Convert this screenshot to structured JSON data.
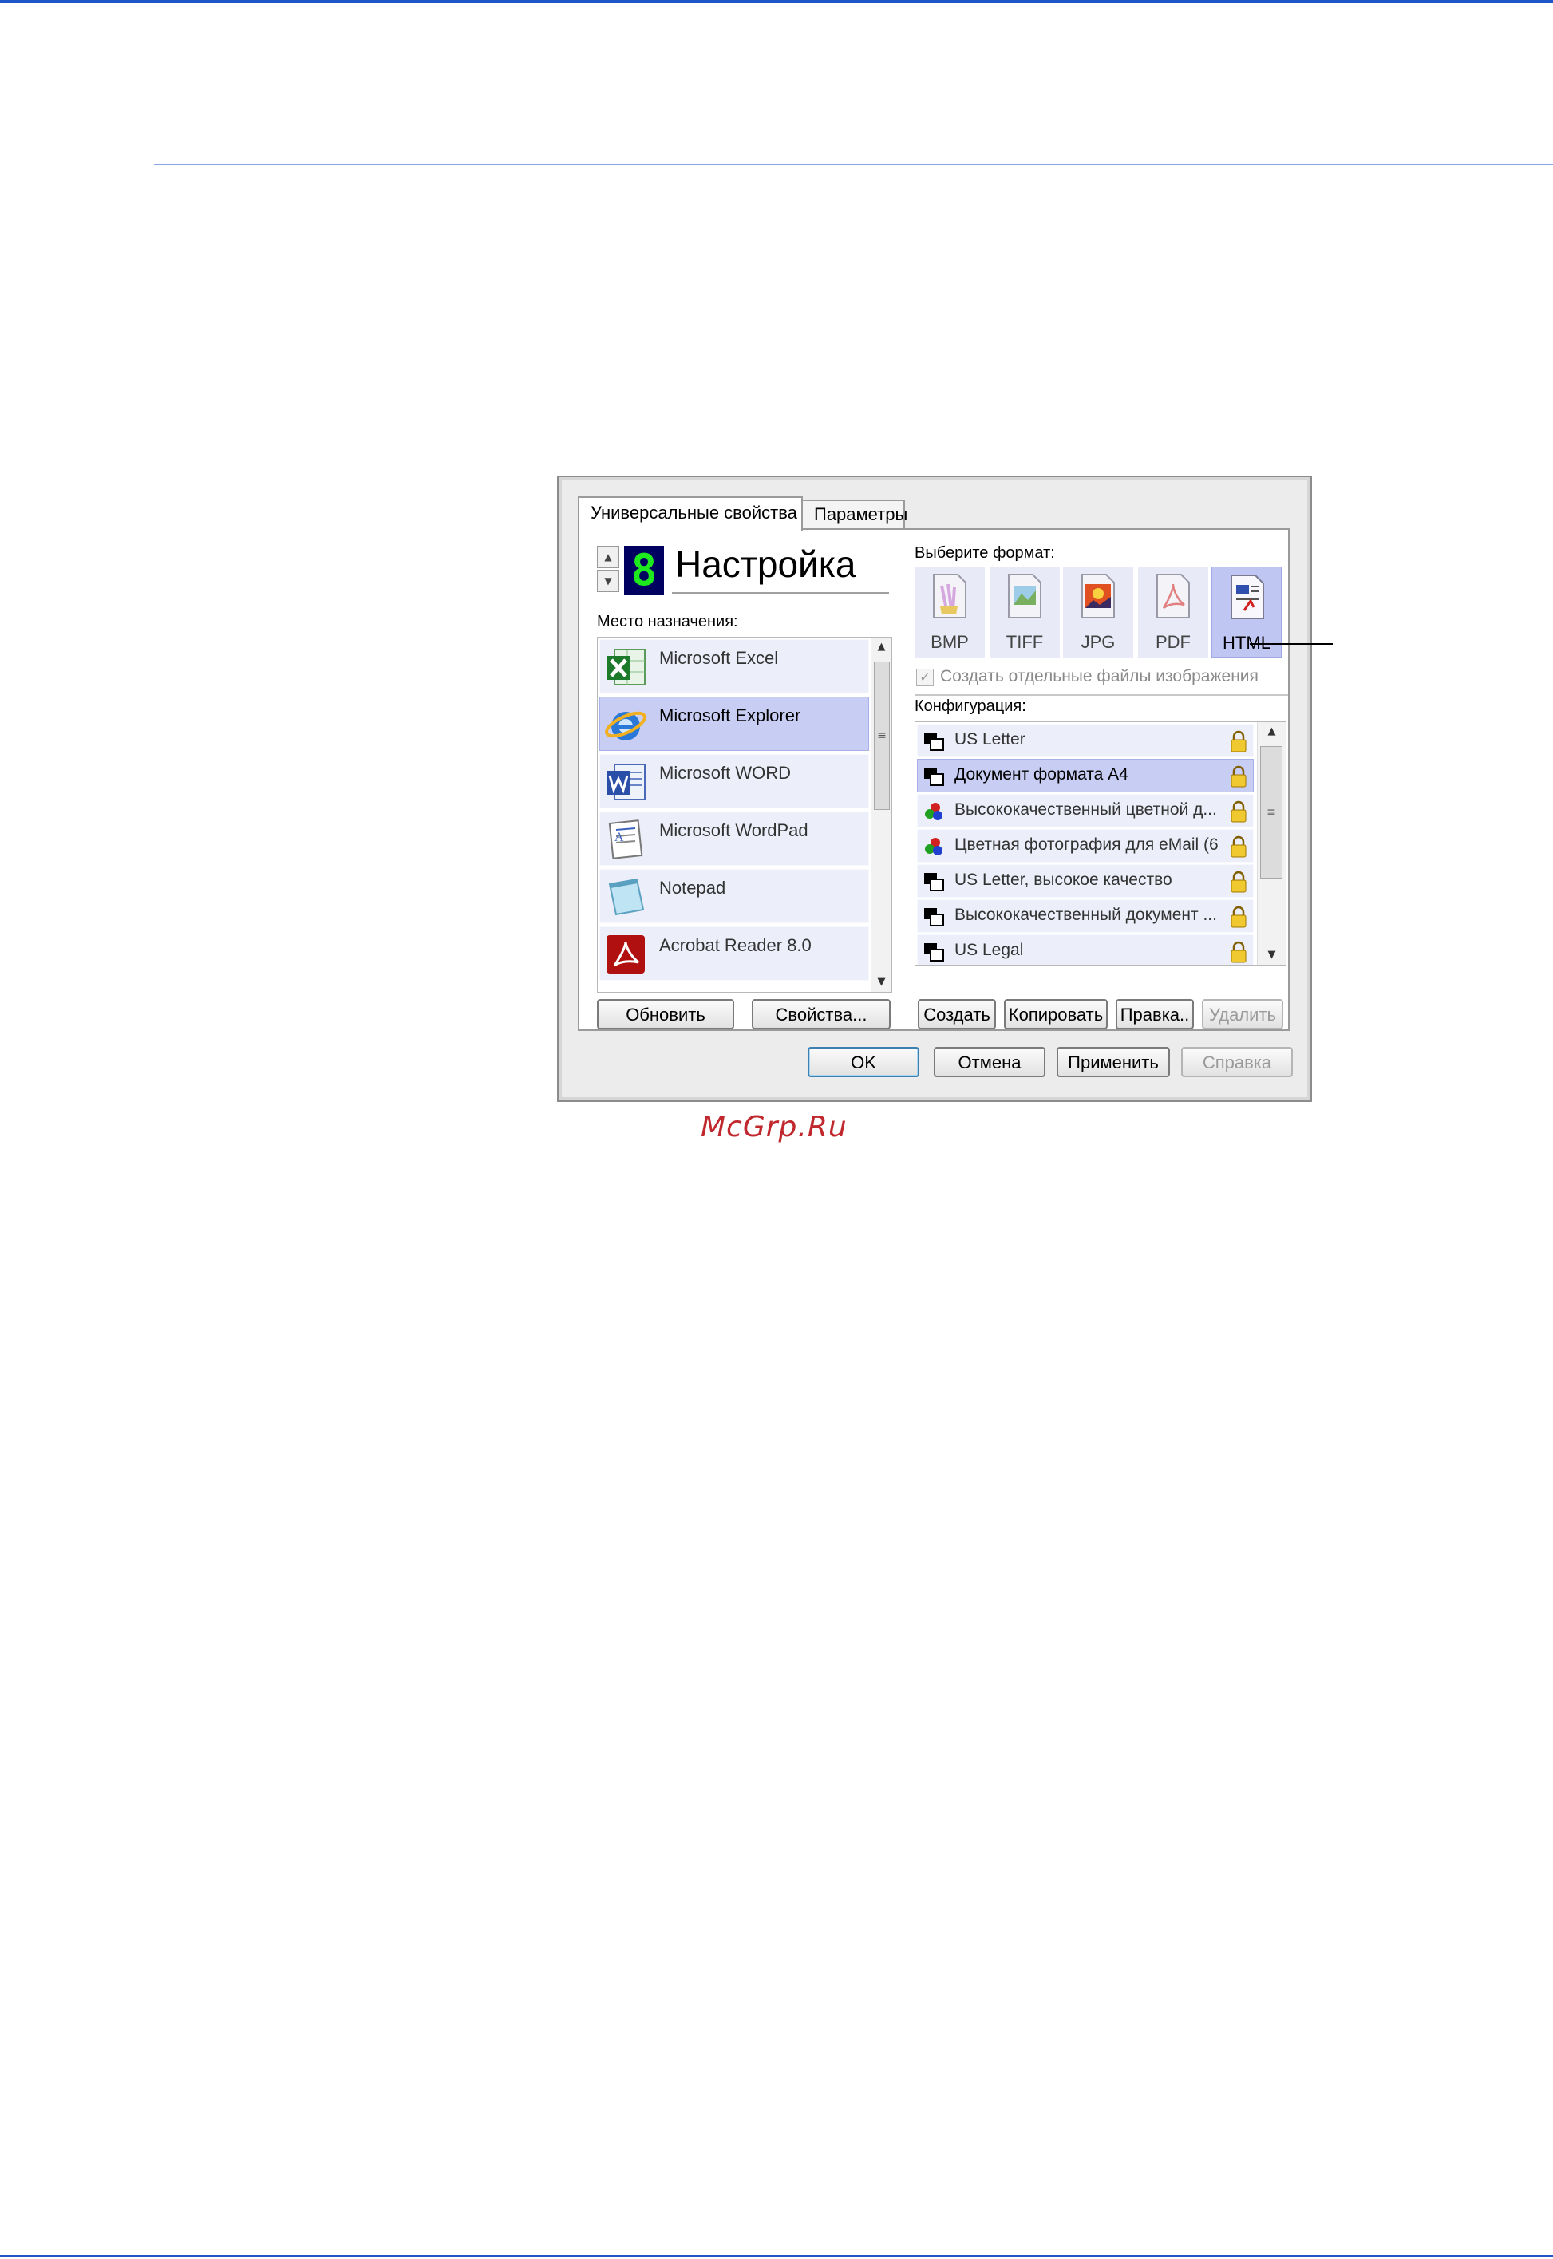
{
  "watermark": "McGrp.Ru",
  "dialog": {
    "tabs": [
      {
        "label": "Универсальные свойства",
        "active": true
      },
      {
        "label": "Параметры",
        "active": false
      }
    ],
    "profile": {
      "number": "8",
      "name": "Настройка"
    },
    "destination": {
      "label": "Место назначения:",
      "items": [
        {
          "label": "Microsoft Excel",
          "icon": "excel-icon",
          "selected": false
        },
        {
          "label": "Microsoft Explorer",
          "icon": "internet-explorer-icon",
          "selected": true
        },
        {
          "label": "Microsoft WORD",
          "icon": "word-icon",
          "selected": false
        },
        {
          "label": "Microsoft WordPad",
          "icon": "wordpad-icon",
          "selected": false
        },
        {
          "label": "Notepad",
          "icon": "notepad-icon",
          "selected": false
        },
        {
          "label": "Acrobat Reader 8.0",
          "icon": "acrobat-icon",
          "selected": false
        }
      ],
      "buttons": {
        "refresh": "Обновить",
        "properties": "Свойства..."
      }
    },
    "format": {
      "label": "Выберите формат:",
      "items": [
        {
          "label": "BMP",
          "selected": false
        },
        {
          "label": "TIFF",
          "selected": false
        },
        {
          "label": "JPG",
          "selected": false
        },
        {
          "label": "PDF",
          "selected": false
        },
        {
          "label": "HTML",
          "selected": true
        }
      ],
      "separate_files": {
        "label": "Создать отдельные файлы изображения",
        "checked": true,
        "disabled": true
      }
    },
    "configuration": {
      "label": "Конфигурация:",
      "items": [
        {
          "label": "US Letter",
          "icon": "bw-document-icon",
          "selected": false
        },
        {
          "label": "Документ формата А4",
          "icon": "bw-document-icon",
          "selected": true
        },
        {
          "label": "Высококачественный цветной д...",
          "icon": "color-document-icon",
          "selected": false
        },
        {
          "label": "Цветная фотография для eMail (6...",
          "icon": "color-document-icon",
          "selected": false
        },
        {
          "label": "US Letter, высокое качество",
          "icon": "bw-document-icon",
          "selected": false
        },
        {
          "label": "Высококачественный документ ...",
          "icon": "bw-document-icon",
          "selected": false
        },
        {
          "label": "US Legal",
          "icon": "bw-document-icon",
          "selected": false
        }
      ],
      "buttons": {
        "create": "Создать",
        "copy": "Копировать",
        "edit": "Правка..",
        "delete": "Удалить"
      }
    },
    "footer": {
      "ok": "OK",
      "cancel": "Отмена",
      "apply": "Применить",
      "help": "Справка"
    }
  }
}
